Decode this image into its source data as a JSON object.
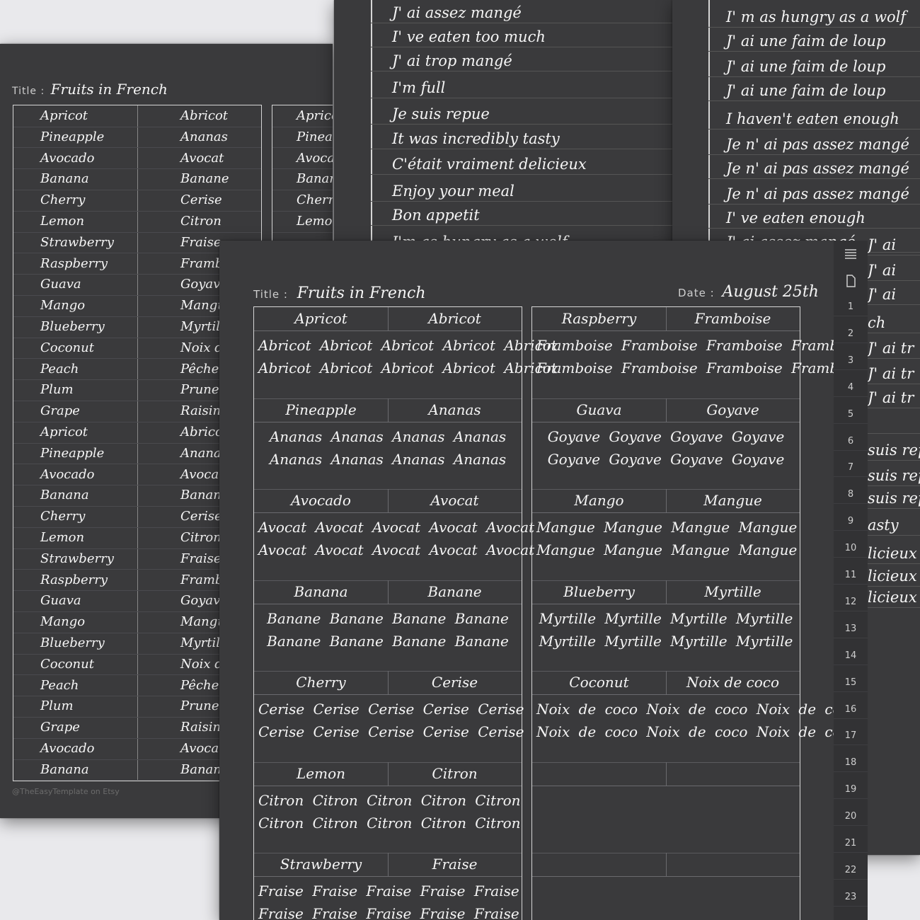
{
  "left_sheet": {
    "title_label": "Title :",
    "title_value": "Fruits in French",
    "rows": [
      {
        "en": "Apricot",
        "fr": "Abricot"
      },
      {
        "en": "Pineapple",
        "fr": "Ananas"
      },
      {
        "en": "Avocado",
        "fr": "Avocat"
      },
      {
        "en": "Banana",
        "fr": "Banane"
      },
      {
        "en": "Cherry",
        "fr": "Cerise"
      },
      {
        "en": "Lemon",
        "fr": "Citron"
      },
      {
        "en": "Strawberry",
        "fr": "Fraise"
      },
      {
        "en": "Raspberry",
        "fr": "Framboise"
      },
      {
        "en": "Guava",
        "fr": "Goyave"
      },
      {
        "en": "Mango",
        "fr": "Mangue"
      },
      {
        "en": "Blueberry",
        "fr": "Myrtille"
      },
      {
        "en": "Coconut",
        "fr": "Noix de coco"
      },
      {
        "en": "Peach",
        "fr": "Pêche"
      },
      {
        "en": "Plum",
        "fr": "Prune"
      },
      {
        "en": "Grape",
        "fr": "Raisin"
      },
      {
        "en": "Apricot",
        "fr": "Abricot"
      },
      {
        "en": "Pineapple",
        "fr": "Ananas"
      },
      {
        "en": "Avocado",
        "fr": "Avocat"
      },
      {
        "en": "Banana",
        "fr": "Banane"
      },
      {
        "en": "Cherry",
        "fr": "Cerise"
      },
      {
        "en": "Lemon",
        "fr": "Citron"
      },
      {
        "en": "Strawberry",
        "fr": "Fraise"
      },
      {
        "en": "Raspberry",
        "fr": "Framboise"
      },
      {
        "en": "Guava",
        "fr": "Goyave"
      },
      {
        "en": "Mango",
        "fr": "Mangue"
      },
      {
        "en": "Blueberry",
        "fr": "Myrtille"
      },
      {
        "en": "Coconut",
        "fr": "Noix de coco"
      },
      {
        "en": "Peach",
        "fr": "Pêche"
      },
      {
        "en": "Plum",
        "fr": "Prune"
      },
      {
        "en": "Grape",
        "fr": "Raisin"
      },
      {
        "en": "Avocado",
        "fr": "Avocat"
      },
      {
        "en": "Banana",
        "fr": "Banane"
      }
    ],
    "second_column": [
      "Apricot",
      "Pineapple",
      "Avocado",
      "Banana",
      "Cherry",
      "Lemon"
    ],
    "footer": "@TheEasyTemplate on Etsy"
  },
  "mid_sheet": {
    "lines": [
      "J' ai assez mangé",
      "I' ve eaten too much",
      "J' ai trop mangé",
      "I'm full",
      "Je suis repue",
      "It was incredibly tasty",
      "C'était vraiment delicieux",
      "Enjoy your meal",
      "Bon appetit",
      "I'm as hungry as a wolf"
    ]
  },
  "right_sheet": {
    "lines": [
      "I' m as hungry as a wolf",
      "J' ai une faim de loup",
      "J' ai une faim de loup",
      "J' ai une faim de loup",
      "I haven't eaten enough",
      "Je n' ai pas assez mangé",
      "Je n' ai pas assez mangé",
      "Je n' ai pas assez mangé",
      "I' ve eaten enough",
      "J' ai assez mangé"
    ],
    "peek_lines": [
      "J' ai",
      "J' ai",
      "J' ai",
      "ch",
      "J' ai tr",
      "J' ai tr",
      "J' ai tr",
      "",
      "suis rep",
      "suis rep",
      "suis rep",
      "asty",
      "licieux",
      "licieux",
      "licieux"
    ]
  },
  "sidebar": {
    "numbers": [
      "1",
      "2",
      "3",
      "4",
      "5",
      "6",
      "7",
      "8",
      "9",
      "10",
      "11",
      "12",
      "13",
      "14",
      "15",
      "16",
      "17",
      "18",
      "19",
      "20",
      "21",
      "22",
      "23"
    ]
  },
  "front_sheet": {
    "title_label": "Title :",
    "title_value": "Fruits in French",
    "date_label": "Date :",
    "date_value": "August 25th",
    "left_blocks": [
      {
        "en": "Apricot",
        "fr": "Abricot",
        "p1": "Abricot Abricot Abricot Abricot Abricot",
        "p2": "Abricot Abricot Abricot Abricot Abricot"
      },
      {
        "en": "Pineapple",
        "fr": "Ananas",
        "p1": "Ananas Ananas Ananas Ananas",
        "p2": "Ananas Ananas Ananas Ananas"
      },
      {
        "en": "Avocado",
        "fr": "Avocat",
        "p1": "Avocat Avocat Avocat Avocat Avocat",
        "p2": "Avocat Avocat Avocat Avocat Avocat"
      },
      {
        "en": "Banana",
        "fr": "Banane",
        "p1": "Banane Banane Banane Banane",
        "p2": "Banane Banane Banane Banane"
      },
      {
        "en": "Cherry",
        "fr": "Cerise",
        "p1": "Cerise Cerise Cerise Cerise Cerise",
        "p2": "Cerise Cerise Cerise Cerise Cerise"
      },
      {
        "en": "Lemon",
        "fr": "Citron",
        "p1": "Citron Citron Citron Citron Citron",
        "p2": "Citron Citron Citron Citron Citron"
      },
      {
        "en": "Strawberry",
        "fr": "Fraise",
        "p1": "Fraise Fraise Fraise Fraise Fraise",
        "p2": "Fraise Fraise Fraise Fraise Fraise"
      }
    ],
    "right_blocks": [
      {
        "en": "Raspberry",
        "fr": "Framboise",
        "p1": "Framboise Framboise Framboise Framboise",
        "p2": "Framboise Framboise Framboise Framboise"
      },
      {
        "en": "Guava",
        "fr": "Goyave",
        "p1": "Goyave Goyave Goyave Goyave",
        "p2": "Goyave Goyave Goyave Goyave"
      },
      {
        "en": "Mango",
        "fr": "Mangue",
        "p1": "Mangue Mangue Mangue Mangue",
        "p2": "Mangue Mangue Mangue Mangue"
      },
      {
        "en": "Blueberry",
        "fr": "Myrtille",
        "p1": "Myrtille Myrtille Myrtille Myrtille",
        "p2": "Myrtille Myrtille Myrtille Myrtille"
      },
      {
        "en": "Coconut",
        "fr": "Noix de coco",
        "p1": "Noix de coco Noix de coco Noix de coco",
        "p2": "Noix de coco Noix de coco Noix de coco"
      },
      {
        "en": "",
        "fr": "",
        "p1": "",
        "p2": ""
      },
      {
        "en": "",
        "fr": "",
        "p1": "",
        "p2": ""
      }
    ]
  }
}
